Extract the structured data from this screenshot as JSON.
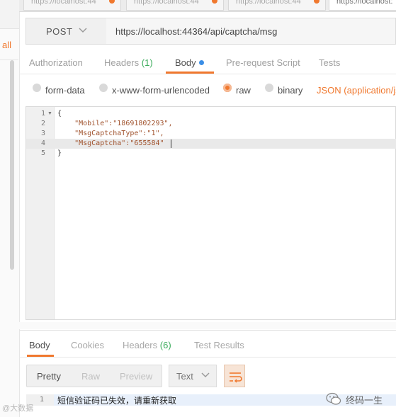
{
  "sidebar": {
    "label": "all"
  },
  "window_tabs": [
    {
      "label": "https://localhost:44"
    },
    {
      "label": "https://localhost:44"
    },
    {
      "label": "https://localhost:44"
    },
    {
      "label": "https://localhost:"
    }
  ],
  "request": {
    "method": "POST",
    "url": "https://localhost:44364/api/captcha/msg"
  },
  "request_tabs": {
    "authorization": "Authorization",
    "headers": "Headers",
    "headers_count": "(1)",
    "body": "Body",
    "prerequest": "Pre-request Script",
    "tests": "Tests"
  },
  "body_modes": {
    "form_data": "form-data",
    "urlencoded": "x-www-form-urlencoded",
    "raw": "raw",
    "binary": "binary",
    "content_type": "JSON (application/json)",
    "selected": "raw"
  },
  "editor": {
    "line_numbers": [
      "1",
      "2",
      "3",
      "4",
      "5"
    ],
    "lines": [
      "{",
      "    \"Mobile\":\"18691802293\",",
      "    \"MsgCaptchaType\":\"1\",",
      "    \"MsgCaptcha\":\"655584\"",
      "}"
    ]
  },
  "response_tabs": {
    "body": "Body",
    "cookies": "Cookies",
    "headers": "Headers",
    "headers_count": "(6)",
    "test_results": "Test Results"
  },
  "view_modes": {
    "pretty": "Pretty",
    "raw": "Raw",
    "preview": "Preview",
    "format": "Text"
  },
  "response": {
    "line_number": "1",
    "text": "短信验证码已失效，请重新获取"
  },
  "watermarks": {
    "left": "@大数据",
    "right": "终码一生"
  },
  "colors": {
    "accent": "#f0782e",
    "count_green": "#3cac5c",
    "body_dot": "#3b8ee6"
  }
}
